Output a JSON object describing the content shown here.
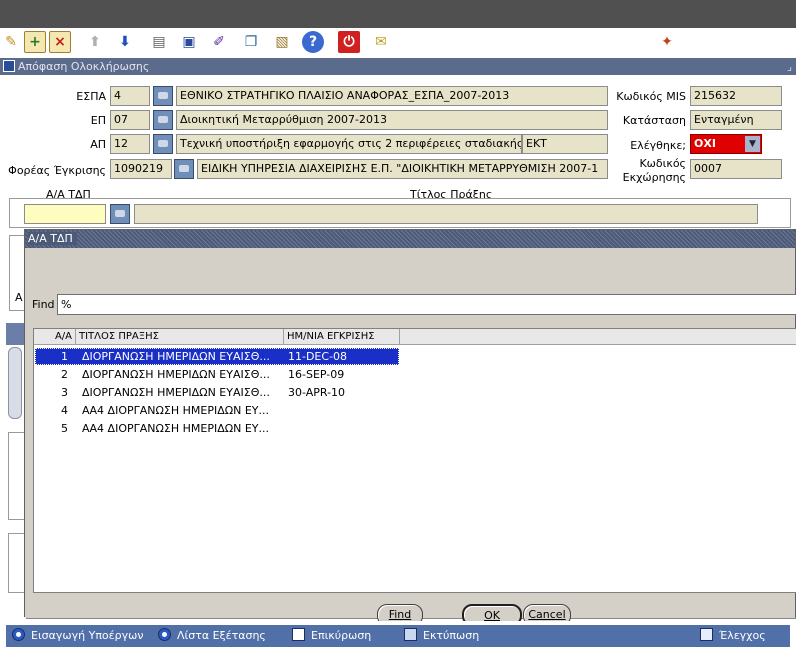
{
  "form": {
    "title": "Απόφαση Ολοκλήρωσης",
    "fields": {
      "espa_label": "ΕΣΠΑ",
      "espa_code": "4",
      "espa_desc": "ΕΘΝΙΚΟ ΣΤΡΑΤΗΓΙΚΟ ΠΛΑΙΣΙΟ ΑΝΑΦΟΡΑΣ_ΕΣΠΑ_2007-2013",
      "ep_label": "ΕΠ",
      "ep_code": "07",
      "ep_desc": "Διοικητική Μεταρρύθμιση 2007-2013",
      "ap_label": "ΑΠ",
      "ap_code": "12",
      "ap_desc": "Τεχνική υποστήριξη εφαρμογής στις 2 περιφέρειες σταδιακής εισ",
      "ap_fund": "ΕΚΤ",
      "foreas_label": "Φορέας Έγκρισης",
      "foreas_code": "1090219",
      "foreas_desc": "ΕΙΔΙΚΗ ΥΠΗΡΕΣΙΑ ΔΙΑΧΕΙΡΙΣΗΣ Ε.Π. \"ΔΙΟΙΚΗΤΙΚΗ ΜΕΤΑΡΡΥΘΜΙΣΗ 2007-1",
      "mis_label": "Κωδικός MIS",
      "mis_value": "215632",
      "status_label": "Κατάσταση",
      "status_value": "Ενταγμένη",
      "checked_label": "Ελέγθηκε;",
      "checked_value": "ΟΧΙ",
      "kodikos_label": "Κωδικός",
      "ekxorisis_label": "Εκχώρησης",
      "ekxorisis_value": "0007"
    },
    "sub_headers": {
      "aa_tdp": "Α/Α ΤΔΠ",
      "titlos_praxis": "Τίτλος Πράξης"
    },
    "left_fragments": {
      "a1": "Α",
      "a2": "Α"
    }
  },
  "dialog": {
    "title": "Α/Α ΤΔΠ",
    "find_label": "Find",
    "find_value": "%",
    "columns": [
      "Α/Α",
      "ΤΙΤΛΟΣ ΠΡΑΞΗΣ",
      "ΗΜ/ΝΙΑ ΕΓΚΡΙΣΗΣ"
    ],
    "rows": [
      {
        "aa": "1",
        "title": "ΔΙΟΡΓΑΝΩΣΗ ΗΜΕΡΙΔΩΝ ΕΥΑΙΣΘ...",
        "date": "11-DEC-08"
      },
      {
        "aa": "2",
        "title": "ΔΙΟΡΓΑΝΩΣΗ ΗΜΕΡΙΔΩΝ ΕΥΑΙΣΘ...",
        "date": "16-SEP-09"
      },
      {
        "aa": "3",
        "title": "ΔΙΟΡΓΑΝΩΣΗ ΗΜΕΡΙΔΩΝ ΕΥΑΙΣΘ...",
        "date": "30-APR-10"
      },
      {
        "aa": "4",
        "title": "ΑΑ4  ΔΙΟΡΓΑΝΩΣΗ ΗΜΕΡΙΔΩΝ ΕΥ...",
        "date": ""
      },
      {
        "aa": "5",
        "title": "ΑΑ4  ΔΙΟΡΓΑΝΩΣΗ ΗΜΕΡΙΔΩΝ ΕΥ...",
        "date": ""
      }
    ],
    "buttons": {
      "find": "Find",
      "ok": "OK",
      "cancel": "Cancel"
    }
  },
  "bottom_bar": {
    "items": [
      {
        "label": "Εισαγωγή Υποέργων",
        "icon": "circle-icon"
      },
      {
        "label": "Λίστα Εξέτασης",
        "icon": "circle-icon"
      },
      {
        "label": "Επικύρωση",
        "icon": "checklist-icon"
      },
      {
        "label": "Εκτύπωση",
        "icon": "print-preview-icon"
      },
      {
        "label": "Έλεγχος",
        "icon": "check-icon"
      }
    ]
  },
  "toolbar": {
    "icons": [
      "edit-icon",
      "insert-record-icon",
      "delete-record-icon",
      "previous-icon",
      "next-icon",
      "print-icon",
      "query-icon",
      "edit-field-icon",
      "copy-icon",
      "paste-icon",
      "help-icon",
      "exit-icon",
      "notes-icon",
      "oracle-icon"
    ]
  },
  "colors": {
    "field_bg": "#e6e3c8",
    "selection": "#1a2ec8",
    "alert": "#e00000",
    "title_bar": "#5b6b8c",
    "bottom_bar": "#5170a8"
  }
}
